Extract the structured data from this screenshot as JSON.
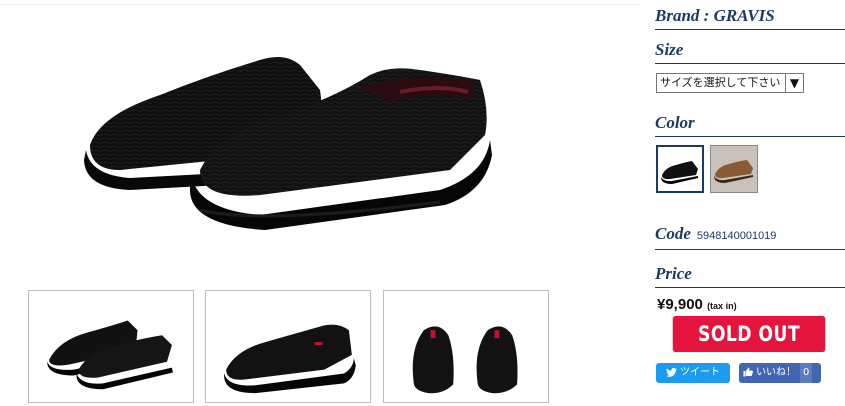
{
  "product": {
    "brand_label": "Brand : GRAVIS",
    "size_label": "Size",
    "size_select_value": "サイズを選択して下さい",
    "color_label": "Color",
    "colors": [
      {
        "name": "black",
        "hex": "#111111"
      },
      {
        "name": "brown",
        "hex": "#8a5a34"
      }
    ],
    "code_label": "Code",
    "code_value": "5948140001019",
    "price_label": "Price",
    "price_value": "¥9,900",
    "tax_note": "(tax in)",
    "sold_out_label": "SOLD OUT"
  },
  "social": {
    "tweet_label": "ツイート",
    "like_label": "いいね！",
    "like_count": "0"
  },
  "gallery": {
    "thumbnails": [
      "pair-side-view",
      "single-side-view",
      "heel-back-view"
    ]
  },
  "colors": {
    "accent": "#1b3a66",
    "sold_out": "#e6143c",
    "twitter": "#1d9bf0",
    "facebook": "#4267b2"
  }
}
